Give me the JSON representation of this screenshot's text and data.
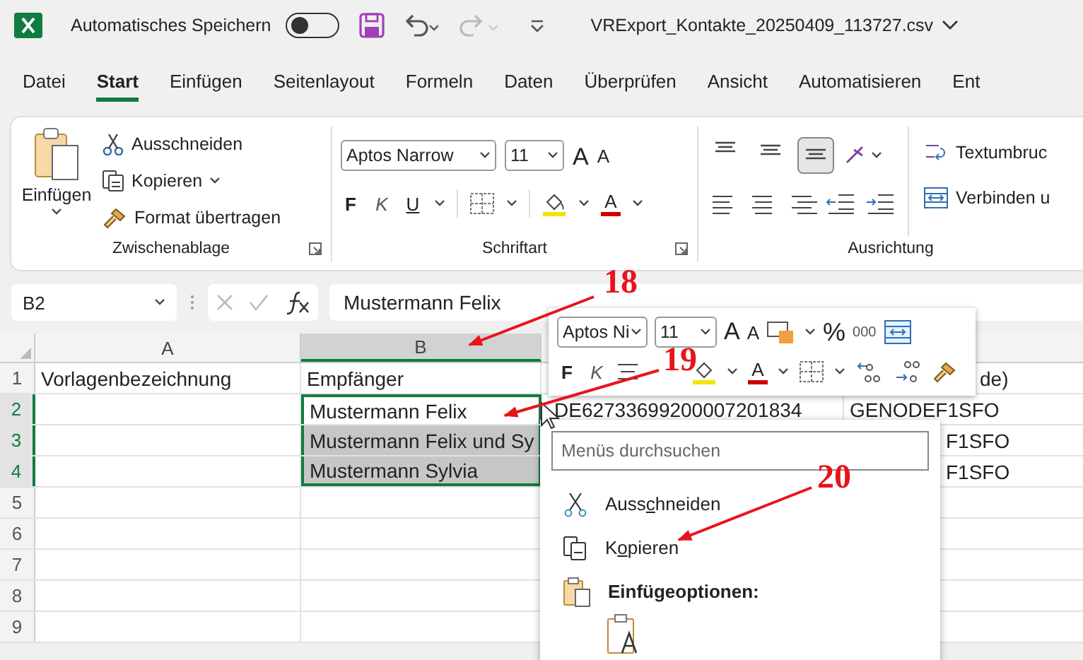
{
  "title_bar": {
    "autosave_label": "Automatisches Speichern",
    "autosave_on": false,
    "filename": "VRExport_Kontakte_20250409_113727.csv"
  },
  "menu_tabs": [
    {
      "label": "Datei",
      "selected": false
    },
    {
      "label": "Start",
      "selected": true
    },
    {
      "label": "Einfügen",
      "selected": false
    },
    {
      "label": "Seitenlayout",
      "selected": false
    },
    {
      "label": "Formeln",
      "selected": false
    },
    {
      "label": "Daten",
      "selected": false
    },
    {
      "label": "Überprüfen",
      "selected": false
    },
    {
      "label": "Ansicht",
      "selected": false
    },
    {
      "label": "Automatisieren",
      "selected": false
    },
    {
      "label": "Ent",
      "selected": false
    }
  ],
  "ribbon": {
    "clipboard": {
      "paste": "Einfügen",
      "cut": "Ausschneiden",
      "copy": "Kopieren",
      "format_painter": "Format übertragen",
      "label": "Zwischenablage"
    },
    "font": {
      "font_name": "Aptos Narrow",
      "font_size": "11",
      "grow": "A",
      "shrink": "A",
      "bold": "F",
      "italic": "K",
      "underline": "U",
      "font_color": "A",
      "label": "Schriftart"
    },
    "alignment": {
      "vertical": [
        {
          "selected": false
        },
        {
          "selected": false
        },
        {
          "selected": true
        }
      ],
      "wrap_text": "Textumbruc",
      "merge": "Verbinden u",
      "label": "Ausrichtung"
    }
  },
  "formula_bar": {
    "name_box": "B2",
    "formula": "Mustermann Felix"
  },
  "sheet": {
    "columns": [
      {
        "label": "A",
        "selected": false
      },
      {
        "label": "B",
        "selected": true
      }
    ],
    "rows": [
      {
        "header": "1",
        "selected": false,
        "col_a": "Vorlagenbezeichnung",
        "col_b": "Empfänger",
        "col_d": "de)"
      },
      {
        "header": "2",
        "selected": true,
        "b_selected": true,
        "b_active": true,
        "col_b": "Mustermann Felix",
        "col_c": "DE62733699200007201834",
        "col_d": "GENODEF1SFO"
      },
      {
        "header": "3",
        "selected": true,
        "b_selected": true,
        "b_active": false,
        "col_b": "Mustermann Felix und Sy",
        "col_d": "F1SFO"
      },
      {
        "header": "4",
        "selected": true,
        "b_selected": true,
        "b_active": false,
        "col_b": "Mustermann Sylvia",
        "col_d": "F1SFO"
      },
      {
        "header": "5",
        "selected": false
      },
      {
        "header": "6",
        "selected": false
      },
      {
        "header": "7",
        "selected": false
      },
      {
        "header": "8",
        "selected": false
      },
      {
        "header": "9",
        "selected": false
      }
    ]
  },
  "mini_toolbar": {
    "font_name": "Aptos Ni",
    "font_size": "11",
    "grow": "A",
    "shrink": "A",
    "percent": "%",
    "thousands": "000",
    "bold": "F",
    "italic": "K",
    "font_color": "A"
  },
  "context_menu": {
    "search_placeholder": "Menüs durchsuchen",
    "items": [
      {
        "kind": "command",
        "label_parts": [
          "Auss",
          "c",
          "hneiden"
        ]
      },
      {
        "kind": "command",
        "label_parts": [
          "K",
          "o",
          "pieren"
        ]
      },
      {
        "kind": "heading",
        "label": "Einfügeoptionen:"
      },
      {
        "kind": "paste_options"
      }
    ]
  },
  "annotations": [
    {
      "number": "18"
    },
    {
      "number": "19"
    },
    {
      "number": "20"
    }
  ]
}
